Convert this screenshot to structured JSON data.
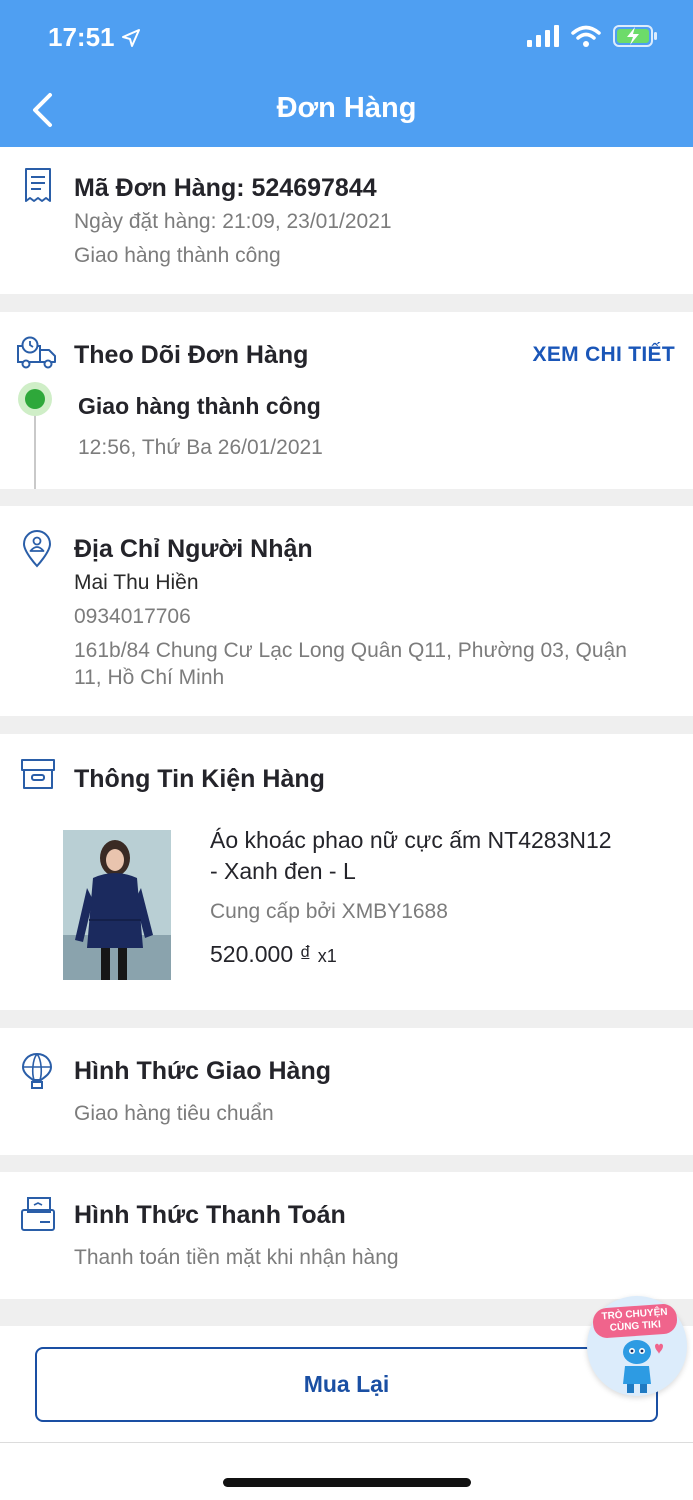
{
  "status_bar": {
    "time": "17:51"
  },
  "header": {
    "title": "Đơn Hàng"
  },
  "order": {
    "code_label": "Mã Đơn Hàng: 524697844",
    "date_label": "Ngày đặt hàng: 21:09, 23/01/2021",
    "status": "Giao hàng thành công"
  },
  "tracking": {
    "title": "Theo Dõi Đơn Hàng",
    "detail_link": "XEM CHI TIẾT",
    "event_status": "Giao hàng thành công",
    "event_time": "12:56, Thứ Ba 26/01/2021"
  },
  "address": {
    "title": "Địa Chỉ Người Nhận",
    "name": "Mai Thu Hiền",
    "phone": "0934017706",
    "line1": "161b/84 Chung Cư Lạc Long Quân Q11, Phường 03, Quận",
    "line2": "11, Hồ Chí Minh"
  },
  "package": {
    "title": "Thông Tin Kiện Hàng",
    "product_name_line1": "Áo khoác phao nữ cực ấm NT4283N12",
    "product_name_line2": "- Xanh đen - L",
    "seller": "Cung cấp bởi XMBY1688",
    "price": "520.000 ₫",
    "quantity": "x1"
  },
  "shipping": {
    "title": "Hình Thức Giao Hàng",
    "method": "Giao hàng tiêu chuẩn"
  },
  "payment": {
    "title": "Hình Thức Thanh Toán",
    "method": "Thanh toán tiền mặt khi nhận hàng"
  },
  "actions": {
    "buy_again": "Mua Lại"
  },
  "chat": {
    "line1": "TRÒ CHUYỆN",
    "line2": "CÙNG TIKI"
  },
  "colors": {
    "header_bg": "#4f9ff2",
    "link": "#1a56b8",
    "status_green": "#2ea83a",
    "button_border": "#1a4fa3"
  },
  "icons": [
    "location-arrow-icon",
    "signal-icon",
    "wifi-icon",
    "battery-charging-icon",
    "back-chevron-icon",
    "receipt-icon",
    "delivery-truck-icon",
    "location-pin-icon",
    "package-box-icon",
    "balloon-icon",
    "payment-card-icon",
    "tiki-mascot-icon"
  ]
}
